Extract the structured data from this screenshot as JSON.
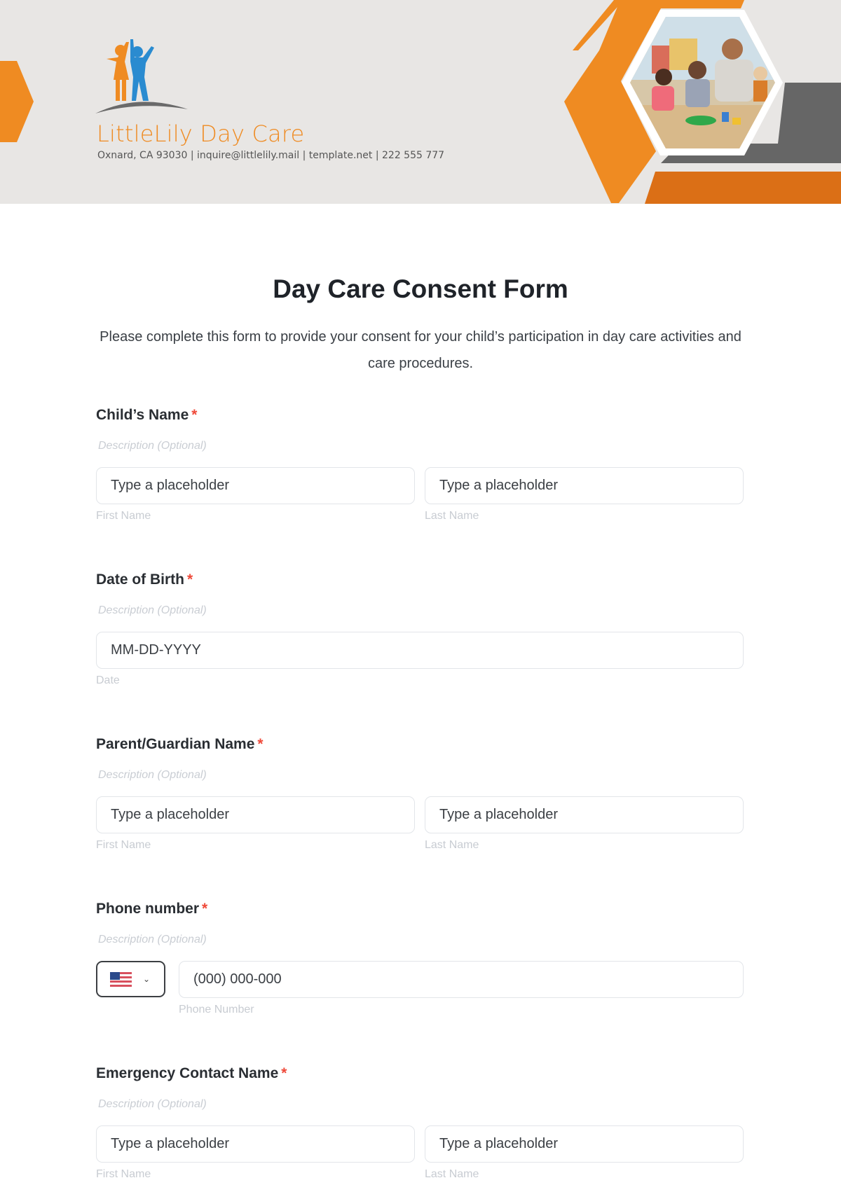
{
  "header": {
    "brand_name": "LittleLily Day Care",
    "brand_info": "Oxnard, CA 93030 | inquire@littlelily.mail | template.net | 222 555 777",
    "colors": {
      "orange": "#ef8b22",
      "dark_orange": "#db6f16",
      "gray": "#666666",
      "blue": "#2a8bd0",
      "background": "#e8e6e4"
    },
    "photo_alt": "Teacher with children playing with blocks"
  },
  "form": {
    "title": "Day Care Consent Form",
    "subtitle": "Please complete this form to provide your consent for your child’s participation in day care activities and care procedures.",
    "required_marker": "*",
    "fields": [
      {
        "label": "Child’s Name",
        "description": "Description (Optional)",
        "inputs": [
          {
            "placeholder": "Type a placeholder",
            "sublabel": "First Name"
          },
          {
            "placeholder": "Type a placeholder",
            "sublabel": "Last Name"
          }
        ]
      },
      {
        "label": "Date of Birth",
        "description": "Description (Optional)",
        "inputs": [
          {
            "placeholder": "MM-DD-YYYY",
            "sublabel": "Date"
          }
        ]
      },
      {
        "label": "Parent/Guardian Name",
        "description": "Description (Optional)",
        "inputs": [
          {
            "placeholder": "Type a placeholder",
            "sublabel": "First Name"
          },
          {
            "placeholder": "Type a placeholder",
            "sublabel": "Last Name"
          }
        ]
      },
      {
        "label": "Phone number",
        "description": "Description (Optional)",
        "country": {
          "selected": "US",
          "icon": "us-flag-icon"
        },
        "inputs": [
          {
            "placeholder": "(000) 000-000",
            "sublabel": "Phone Number"
          }
        ]
      },
      {
        "label": "Emergency Contact Name",
        "description": "Description (Optional)",
        "inputs": [
          {
            "placeholder": "Type a placeholder",
            "sublabel": "First Name"
          },
          {
            "placeholder": "Type a placeholder",
            "sublabel": "Last Name"
          }
        ]
      }
    ]
  }
}
